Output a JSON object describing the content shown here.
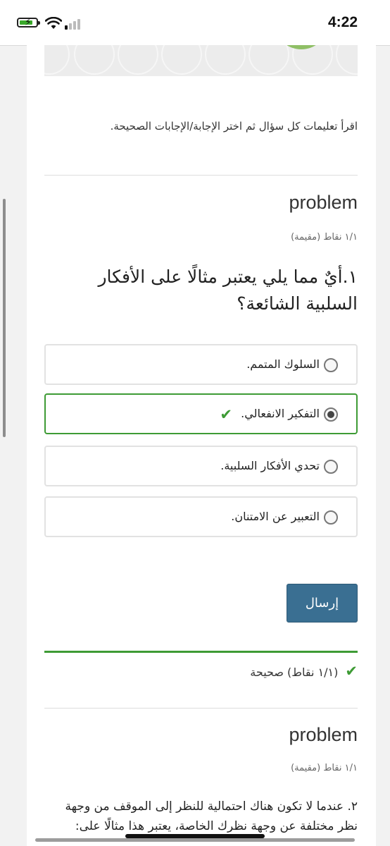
{
  "status_bar": {
    "time": "4:22",
    "battery_icon": "battery-charging-icon",
    "wifi_icon": "wifi-icon",
    "signal_icon": "cellular-signal-icon"
  },
  "instructions": "اقرأ تعليمات كل سؤال ثم اختر الإجابة/الإجابات الصحيحة.",
  "problem1": {
    "title": "problem",
    "points": "١/١ نقاط (مقيمة)",
    "question": "١.أيٌ مما يلي يعتبر مثالًا على الأفكار السلبية الشائعة؟",
    "options": [
      {
        "label": "السلوك المتمم.",
        "selected": false,
        "correct": false
      },
      {
        "label": "التفكير الانفعالي.",
        "selected": true,
        "correct": true
      },
      {
        "label": "تحدي الأفكار السلبية.",
        "selected": false,
        "correct": false
      },
      {
        "label": "التعبير عن الامتنان.",
        "selected": false,
        "correct": false
      }
    ],
    "check_symbol": "✔",
    "submit_label": "إرسال",
    "feedback": "(١/١ نقاط) صحيحة"
  },
  "problem2": {
    "title": "problem",
    "points": "١/١ نقاط (مقيمة)",
    "question": "٢. عندما لا تكون هناك احتمالية للنظر إلى الموقف من وجهة نظر مختلفة عن وجهة نظرك الخاصة، يعتبر هذا مثالًا على:"
  },
  "colors": {
    "correct": "#3e9b35",
    "submit": "#3a6f92",
    "banner_accent": "#8fbf66"
  }
}
